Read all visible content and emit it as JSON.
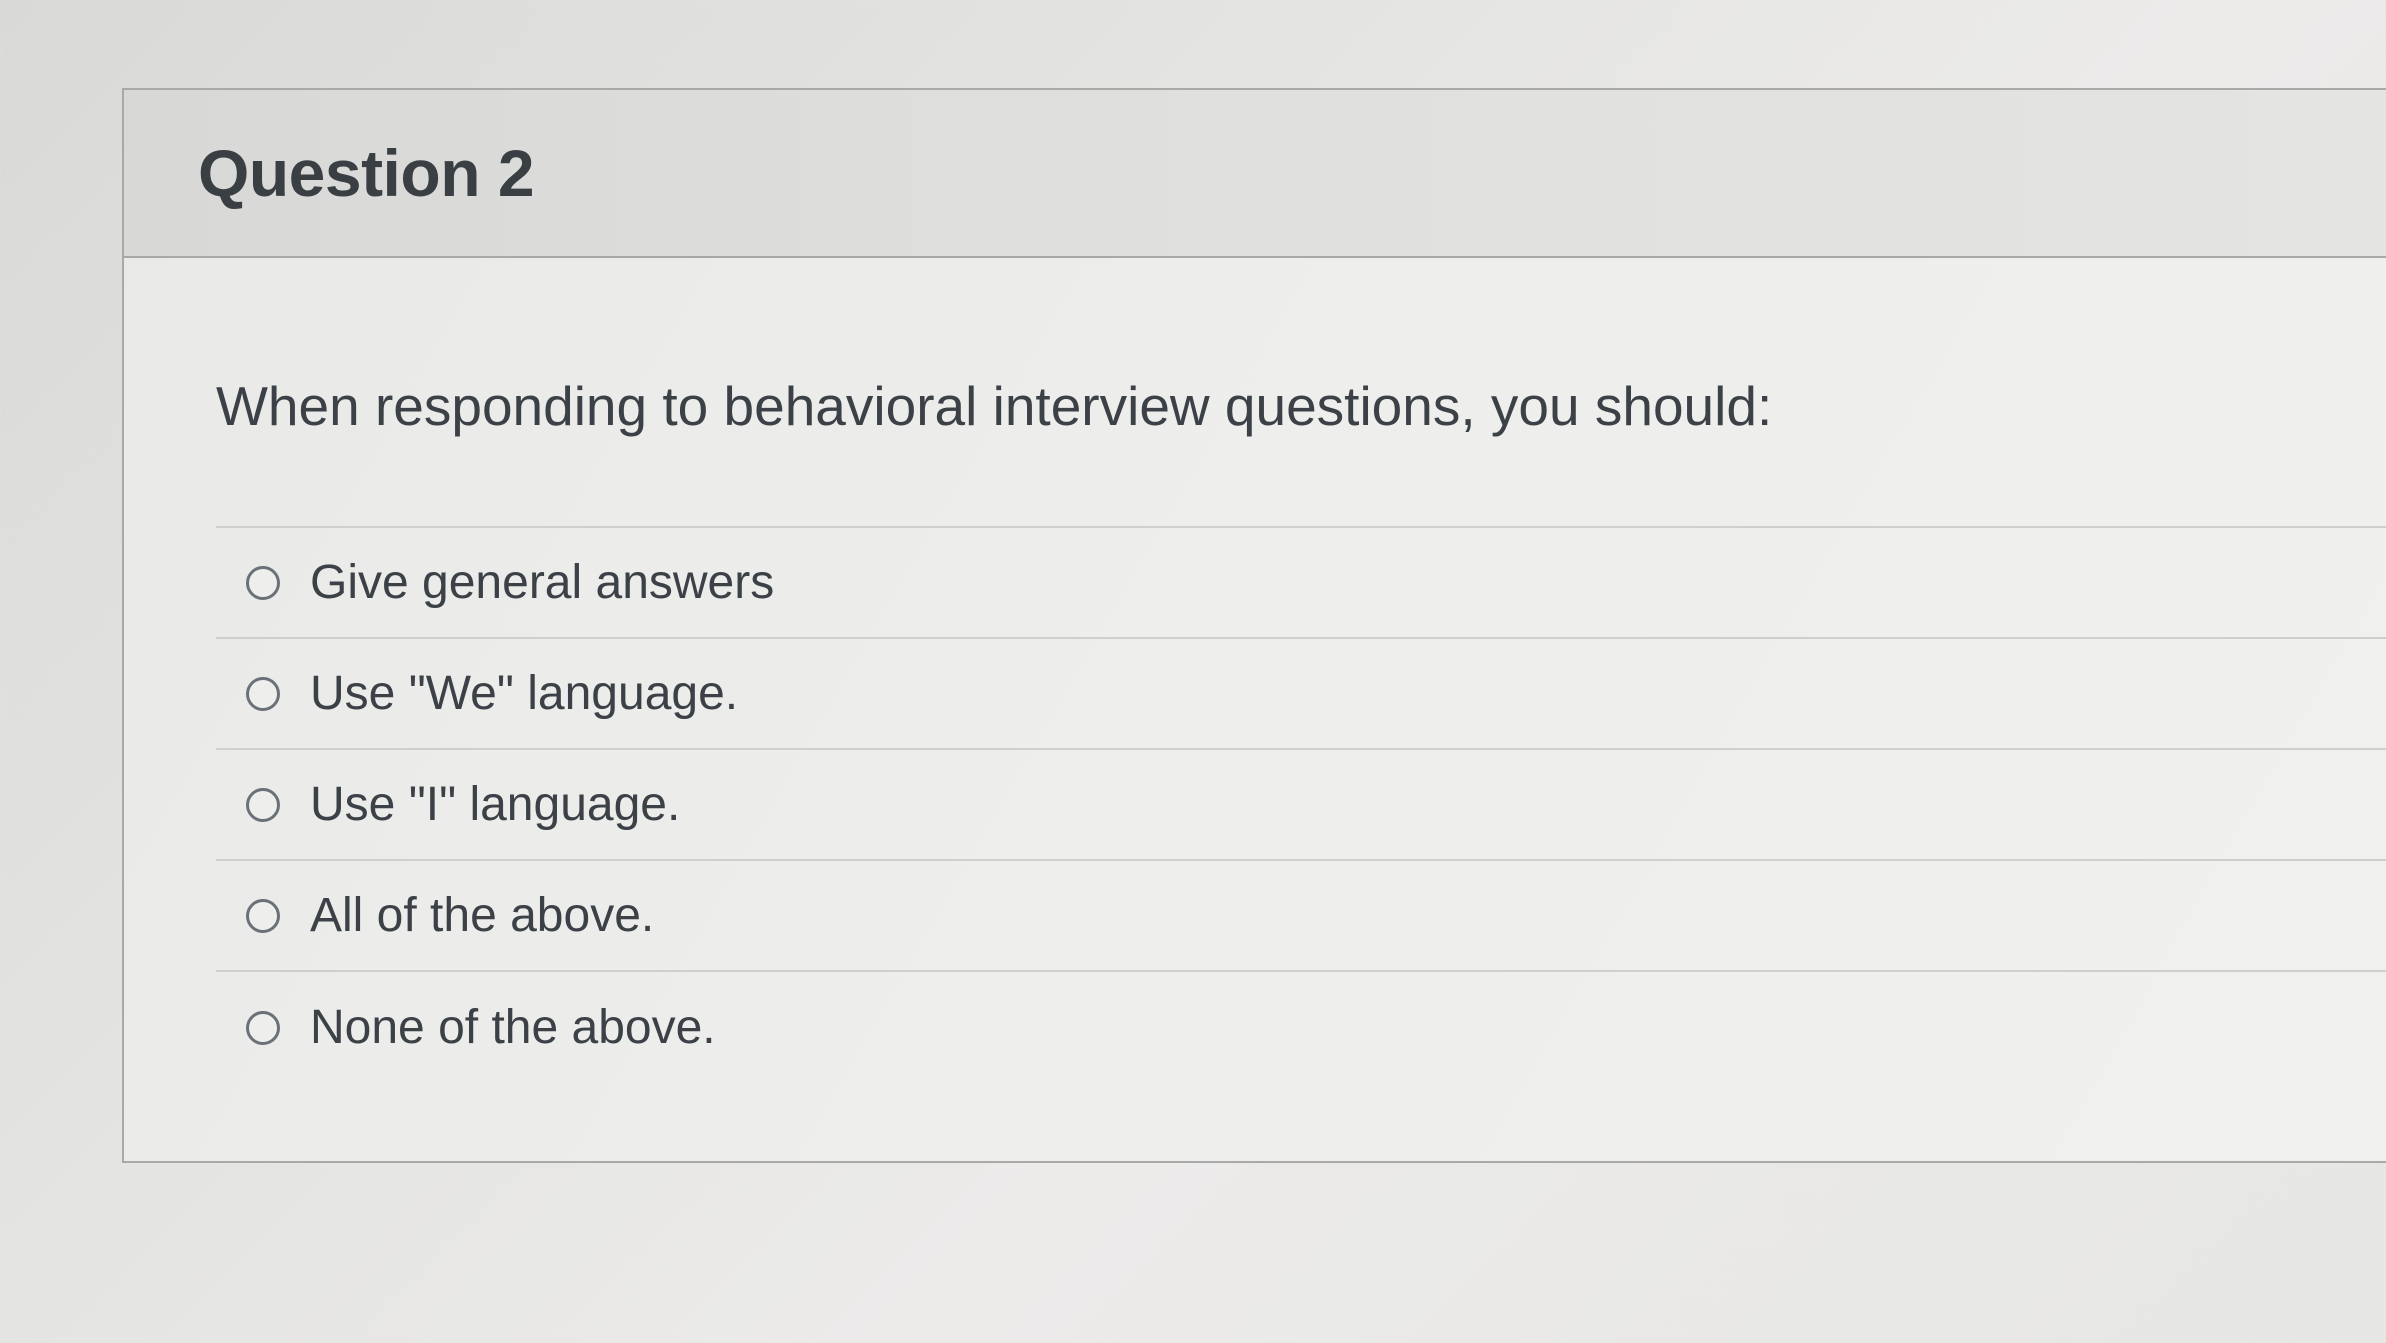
{
  "question": {
    "title": "Question 2",
    "text": "When responding to behavioral interview questions, you should:",
    "answers": [
      {
        "label": "Give general answers"
      },
      {
        "label": "Use \"We\" language."
      },
      {
        "label": "Use \"I\" language."
      },
      {
        "label": "All of the above."
      },
      {
        "label": "None of the above."
      }
    ]
  }
}
